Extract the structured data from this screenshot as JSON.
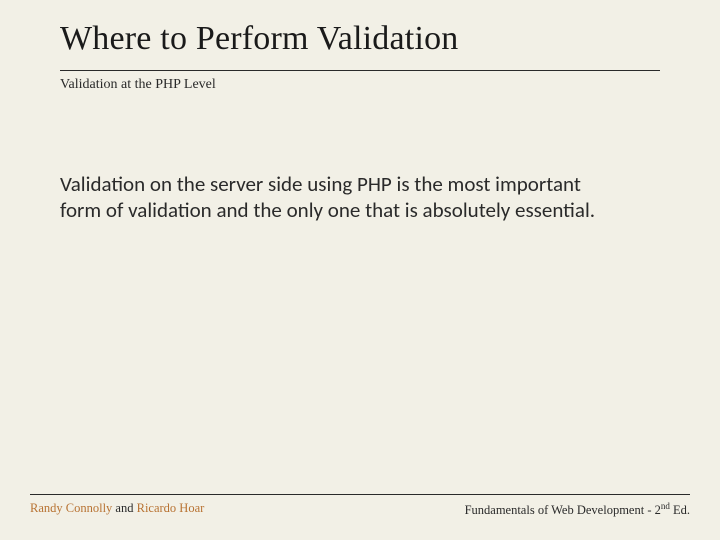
{
  "title": "Where to Perform Validation",
  "subtitle": "Validation at the PHP Level",
  "body": "Validation on the server side using PHP is the most important form of validation and the only one that is absolutely essential.",
  "footer": {
    "author1": "Randy Connolly",
    "joiner": " and ",
    "author2": "Ricardo Hoar",
    "book_prefix": "Fundamentals of Web Development - 2",
    "book_sup": "nd",
    "book_suffix": " Ed."
  }
}
